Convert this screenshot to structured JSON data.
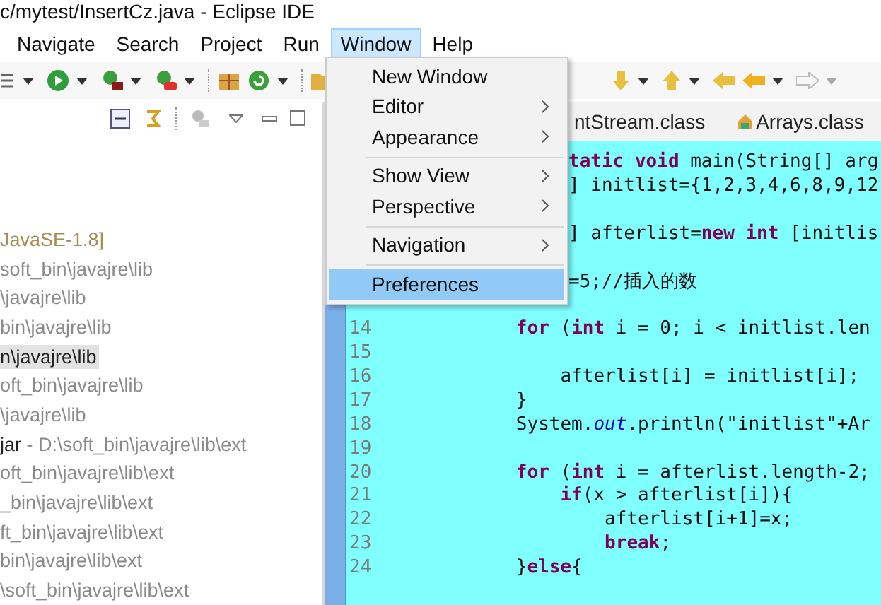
{
  "window": {
    "title": "c/mytest/InsertCz.java - Eclipse IDE"
  },
  "menubar": [
    {
      "label": "Navigate",
      "selected": false
    },
    {
      "label": "Search",
      "selected": false
    },
    {
      "label": "Project",
      "selected": false
    },
    {
      "label": "Run",
      "selected": false
    },
    {
      "label": "Window",
      "selected": true
    },
    {
      "label": "Help",
      "selected": false
    }
  ],
  "window_menu": {
    "groups": [
      [
        {
          "label": "New Window",
          "submenu": false,
          "selected": false
        },
        {
          "label": "Editor",
          "submenu": true,
          "selected": false
        },
        {
          "label": "Appearance",
          "submenu": true,
          "selected": false
        }
      ],
      [
        {
          "label": "Show View",
          "submenu": true,
          "selected": false
        },
        {
          "label": "Perspective",
          "submenu": true,
          "selected": false
        }
      ],
      [
        {
          "label": "Navigation",
          "submenu": true,
          "selected": false
        }
      ],
      [
        {
          "label": "Preferences",
          "submenu": false,
          "selected": true
        }
      ]
    ]
  },
  "package_explorer": {
    "items": [
      {
        "kind": "container",
        "text": "JavaSE-1.8]",
        "selected": false
      },
      {
        "kind": "jar",
        "location": "soft_bin\\javajre\\lib",
        "selected": false
      },
      {
        "kind": "jar",
        "location": "\\javajre\\lib",
        "selected": false
      },
      {
        "kind": "jar",
        "location": "bin\\javajre\\lib",
        "selected": false
      },
      {
        "kind": "jar",
        "location": "n\\javajre\\lib",
        "selected": true
      },
      {
        "kind": "jar",
        "location": "oft_bin\\javajre\\lib",
        "selected": false
      },
      {
        "kind": "jar",
        "location": "\\javajre\\lib",
        "selected": false
      },
      {
        "kind": "jar",
        "name": "jar",
        "location": "- D:\\soft_bin\\javajre\\lib\\ext",
        "selected": false
      },
      {
        "kind": "jar",
        "location": "oft_bin\\javajre\\lib\\ext",
        "selected": false
      },
      {
        "kind": "jar",
        "location": "_bin\\javajre\\lib\\ext",
        "selected": false
      },
      {
        "kind": "jar",
        "location": "ft_bin\\javajre\\lib\\ext",
        "selected": false
      },
      {
        "kind": "jar",
        "location": "bin\\javajre\\lib\\ext",
        "selected": false
      },
      {
        "kind": "jar",
        "location": "\\soft_bin\\javajre\\lib\\ext",
        "selected": false
      }
    ]
  },
  "editor": {
    "tabs": [
      {
        "label": "ntStream.class",
        "selected": false
      },
      {
        "label": "Arrays.class",
        "selected": false
      }
    ],
    "lines": [
      {
        "kind": "partial",
        "text": "**tatic** **void** main(String[] arg"
      },
      {
        "kind": "partial",
        "text": "] initlist={1,2,3,4,6,8,9,12"
      },
      {
        "kind": "blank"
      },
      {
        "kind": "partial",
        "text": "] afterlist=**new** **int** [initlis"
      },
      {
        "kind": "blank"
      },
      {
        "kind": "partial",
        "text": "=5;//插入的数"
      },
      {
        "kind": "blank"
      },
      {
        "kind": "full",
        "number": "14",
        "text": "            **for** (**int** i = 0; i < initlist.len"
      },
      {
        "kind": "full",
        "number": "15"
      },
      {
        "kind": "full",
        "number": "16",
        "text": "                afterlist[i] = initlist[i];"
      },
      {
        "kind": "full",
        "number": "17",
        "text": "            }"
      },
      {
        "kind": "full",
        "number": "18",
        "text": "            System.*out*.println(\"initlist\"+Ar"
      },
      {
        "kind": "full",
        "number": "19"
      },
      {
        "kind": "full",
        "number": "20",
        "text": "            **for** (**int** i = afterlist.length-2;"
      },
      {
        "kind": "full",
        "number": "21",
        "text": "                **if**(x > afterlist[i]){"
      },
      {
        "kind": "full",
        "number": "22",
        "text": "                    afterlist[i+1]=x;"
      },
      {
        "kind": "full",
        "number": "23",
        "text": "                    **break**;"
      },
      {
        "kind": "full",
        "number": "24",
        "text": "            }**else**{"
      }
    ]
  }
}
